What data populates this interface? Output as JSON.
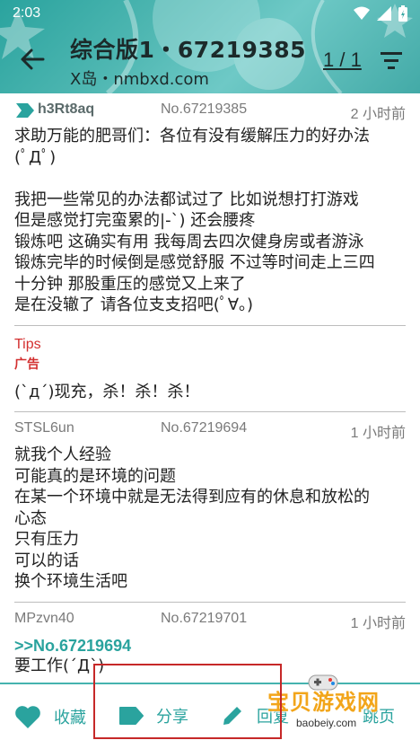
{
  "status_bar": {
    "time": "2:03"
  },
  "header": {
    "title": "综合版1・67219385",
    "subtitle": "X岛・nmbxd.com",
    "page_indicator": "1 / 1"
  },
  "posts": [
    {
      "user": "h3Rt8aq",
      "number": "No.67219385",
      "time": "2 小时前",
      "body": "求助万能的肥哥们：各位有没有缓解压力的好办法\n(ﾟДﾟ)\n\n我把一些常见的办法都试过了 比如说想打打游戏\n但是感觉打完蛮累的|-`) 还会腰疼\n锻炼吧 这确实有用 我每周去四次健身房或者游泳\n锻炼完毕的时候倒是感觉舒服 不过等时间走上三四\n十分钟 那股重压的感觉又上来了\n是在没辙了 请各位支支招吧(ﾟ∀。)"
    },
    {
      "user": "STSL6un",
      "number": "No.67219694",
      "time": "1 小时前",
      "body": "就我个人经验\n可能真的是环境的问题\n在某一个环境中就是无法得到应有的休息和放松的\n心态\n只有压力\n可以的话\n换个环境生活吧"
    },
    {
      "user": "MPzvn40",
      "number": "No.67219701",
      "time": "1 小时前",
      "quote": ">>No.67219694",
      "body": "要工作(´Д`)"
    }
  ],
  "tips": {
    "label": "Tips",
    "ad": "广告",
    "text": "(`д´)现充，杀！杀！杀！"
  },
  "bottom_bar": {
    "favorite": "收藏",
    "share": "分享",
    "reply": "回复",
    "jump": "跳页"
  },
  "watermark": {
    "text": "宝贝游戏网",
    "url": "baobeiy.com"
  },
  "colors": {
    "accent": "#2aa39e",
    "tips": "#d32f2f",
    "highlight_box": "#c62828"
  }
}
